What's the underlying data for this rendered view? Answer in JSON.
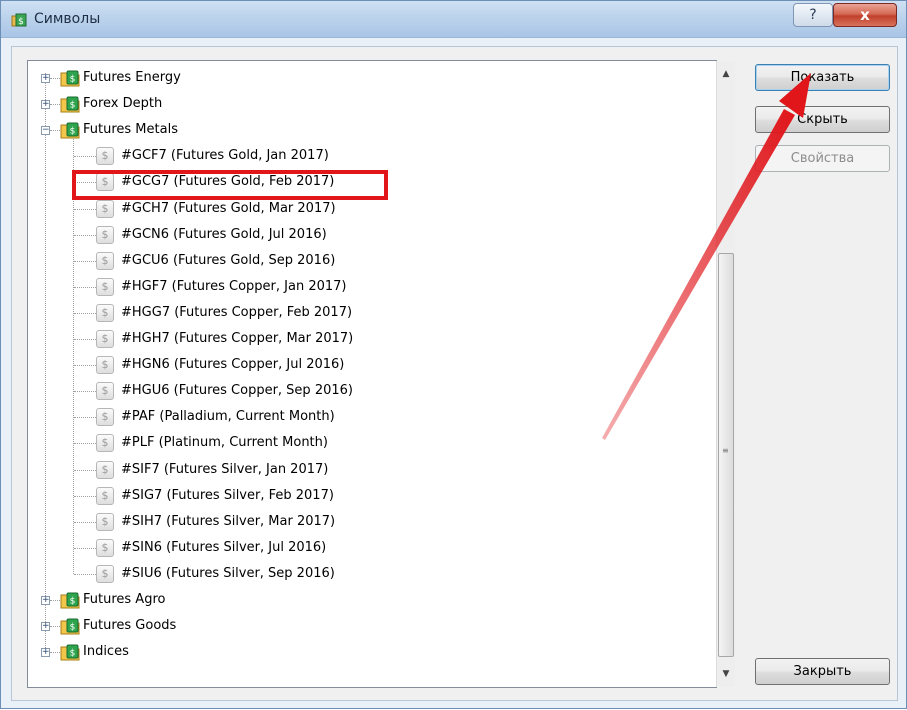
{
  "window": {
    "title": "Символы",
    "help_label": "?",
    "close_label": "x"
  },
  "buttons": {
    "show": "Показать",
    "hide": "Скрыть",
    "properties": "Свойства",
    "close": "Закрыть"
  },
  "tree": {
    "groups_top": [
      "Futures Energy",
      "Forex Depth",
      "Futures Metals"
    ],
    "expanded_group": "Futures Metals",
    "symbols": [
      "#GCF7  (Futures Gold, Jan 2017)",
      "#GCG7  (Futures Gold, Feb 2017)",
      "#GCH7  (Futures Gold, Mar 2017)",
      "#GCN6  (Futures Gold, Jul 2016)",
      "#GCU6  (Futures Gold, Sep 2016)",
      "#HGF7  (Futures Copper, Jan 2017)",
      "#HGG7  (Futures Copper, Feb 2017)",
      "#HGH7  (Futures Copper, Mar 2017)",
      "#HGN6  (Futures Copper, Jul 2016)",
      "#HGU6  (Futures Copper, Sep 2016)",
      "#PAF  (Palladium, Current Month)",
      "#PLF  (Platinum, Current Month)",
      "#SIF7  (Futures Silver, Jan 2017)",
      "#SIG7  (Futures Silver, Feb 2017)",
      "#SIH7  (Futures Silver, Mar 2017)",
      "#SIN6  (Futures Silver, Jul 2016)",
      "#SIU6  (Futures Silver, Sep 2016)"
    ],
    "groups_bottom": [
      "Futures Agro",
      "Futures Goods",
      "Indices"
    ],
    "highlighted_symbol": "#GCG7  (Futures Gold, Feb 2017)"
  },
  "icons": {
    "group": "folder-dollar-icon",
    "symbol": "dollar-icon",
    "symbol_glyph": "$",
    "expand": "+",
    "collapse": "−"
  },
  "colors": {
    "highlight": "#e0161b",
    "arrow": "#e0161b",
    "titlebar": "#bcd3ec"
  }
}
